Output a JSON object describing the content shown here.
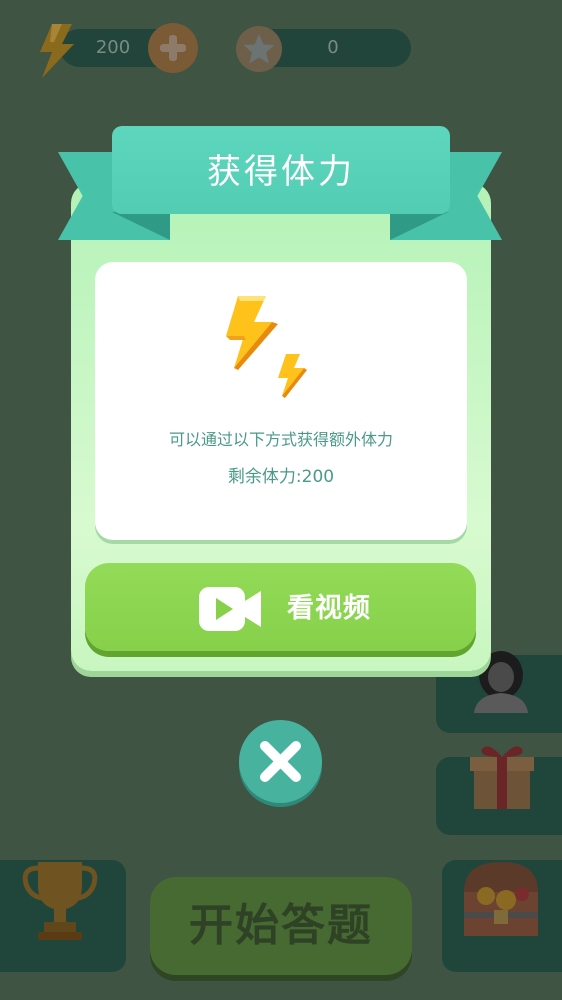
{
  "topbar": {
    "energy_value": "200",
    "star_value": "0"
  },
  "dialog": {
    "title": "获得体力",
    "description": "可以通过以下方式获得额外体力",
    "remaining_label": "剩余体力:200",
    "watch_video_label": "看视频"
  },
  "bottom": {
    "start_label": "开始答题"
  },
  "icons": {
    "energy": "lightning-bolt-icon",
    "add": "plus-icon",
    "star": "star-icon",
    "video": "video-camera-icon",
    "close": "close-icon",
    "avatar": "avatar-icon",
    "gift": "gift-icon",
    "trophy": "trophy-icon",
    "treasure": "treasure-chest-icon"
  },
  "colors": {
    "ribbon": "#52cdb3",
    "watch_button": "#8ad54e",
    "text_teal": "#4a9a88",
    "bolt_yellow": "#ffc21a"
  }
}
